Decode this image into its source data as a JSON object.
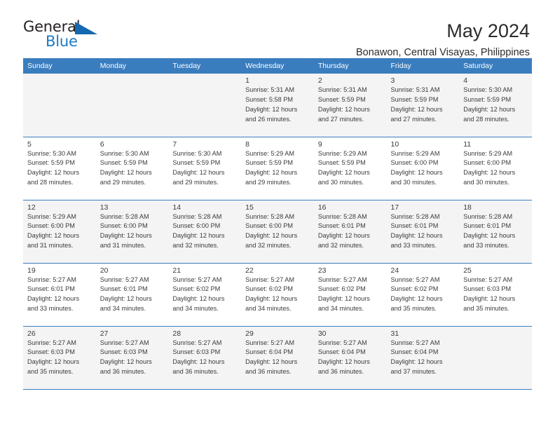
{
  "brand": {
    "name_top": "General",
    "name_bottom": "Blue",
    "triangle_color": "#1569b0",
    "blue_color": "#1a7bc4"
  },
  "header": {
    "title": "May 2024",
    "subtitle": "Bonawon, Central Visayas, Philippines"
  },
  "theme": {
    "accent": "#3a7dbf",
    "alt_row_bg": "#f4f4f4",
    "text": "#3b3b3b"
  },
  "weekday_headers": [
    "Sunday",
    "Monday",
    "Tuesday",
    "Wednesday",
    "Thursday",
    "Friday",
    "Saturday"
  ],
  "labels": {
    "sunrise": "Sunrise:",
    "sunset": "Sunset:",
    "daylight": "Daylight:"
  },
  "weeks": [
    [
      {
        "day": "",
        "sunrise": "",
        "sunset": "",
        "daylight1": "",
        "daylight2": ""
      },
      {
        "day": "",
        "sunrise": "",
        "sunset": "",
        "daylight1": "",
        "daylight2": ""
      },
      {
        "day": "",
        "sunrise": "",
        "sunset": "",
        "daylight1": "",
        "daylight2": ""
      },
      {
        "day": "1",
        "sunrise": "Sunrise: 5:31 AM",
        "sunset": "Sunset: 5:58 PM",
        "daylight1": "Daylight: 12 hours",
        "daylight2": "and 26 minutes."
      },
      {
        "day": "2",
        "sunrise": "Sunrise: 5:31 AM",
        "sunset": "Sunset: 5:59 PM",
        "daylight1": "Daylight: 12 hours",
        "daylight2": "and 27 minutes."
      },
      {
        "day": "3",
        "sunrise": "Sunrise: 5:31 AM",
        "sunset": "Sunset: 5:59 PM",
        "daylight1": "Daylight: 12 hours",
        "daylight2": "and 27 minutes."
      },
      {
        "day": "4",
        "sunrise": "Sunrise: 5:30 AM",
        "sunset": "Sunset: 5:59 PM",
        "daylight1": "Daylight: 12 hours",
        "daylight2": "and 28 minutes."
      }
    ],
    [
      {
        "day": "5",
        "sunrise": "Sunrise: 5:30 AM",
        "sunset": "Sunset: 5:59 PM",
        "daylight1": "Daylight: 12 hours",
        "daylight2": "and 28 minutes."
      },
      {
        "day": "6",
        "sunrise": "Sunrise: 5:30 AM",
        "sunset": "Sunset: 5:59 PM",
        "daylight1": "Daylight: 12 hours",
        "daylight2": "and 29 minutes."
      },
      {
        "day": "7",
        "sunrise": "Sunrise: 5:30 AM",
        "sunset": "Sunset: 5:59 PM",
        "daylight1": "Daylight: 12 hours",
        "daylight2": "and 29 minutes."
      },
      {
        "day": "8",
        "sunrise": "Sunrise: 5:29 AM",
        "sunset": "Sunset: 5:59 PM",
        "daylight1": "Daylight: 12 hours",
        "daylight2": "and 29 minutes."
      },
      {
        "day": "9",
        "sunrise": "Sunrise: 5:29 AM",
        "sunset": "Sunset: 5:59 PM",
        "daylight1": "Daylight: 12 hours",
        "daylight2": "and 30 minutes."
      },
      {
        "day": "10",
        "sunrise": "Sunrise: 5:29 AM",
        "sunset": "Sunset: 6:00 PM",
        "daylight1": "Daylight: 12 hours",
        "daylight2": "and 30 minutes."
      },
      {
        "day": "11",
        "sunrise": "Sunrise: 5:29 AM",
        "sunset": "Sunset: 6:00 PM",
        "daylight1": "Daylight: 12 hours",
        "daylight2": "and 30 minutes."
      }
    ],
    [
      {
        "day": "12",
        "sunrise": "Sunrise: 5:29 AM",
        "sunset": "Sunset: 6:00 PM",
        "daylight1": "Daylight: 12 hours",
        "daylight2": "and 31 minutes."
      },
      {
        "day": "13",
        "sunrise": "Sunrise: 5:28 AM",
        "sunset": "Sunset: 6:00 PM",
        "daylight1": "Daylight: 12 hours",
        "daylight2": "and 31 minutes."
      },
      {
        "day": "14",
        "sunrise": "Sunrise: 5:28 AM",
        "sunset": "Sunset: 6:00 PM",
        "daylight1": "Daylight: 12 hours",
        "daylight2": "and 32 minutes."
      },
      {
        "day": "15",
        "sunrise": "Sunrise: 5:28 AM",
        "sunset": "Sunset: 6:00 PM",
        "daylight1": "Daylight: 12 hours",
        "daylight2": "and 32 minutes."
      },
      {
        "day": "16",
        "sunrise": "Sunrise: 5:28 AM",
        "sunset": "Sunset: 6:01 PM",
        "daylight1": "Daylight: 12 hours",
        "daylight2": "and 32 minutes."
      },
      {
        "day": "17",
        "sunrise": "Sunrise: 5:28 AM",
        "sunset": "Sunset: 6:01 PM",
        "daylight1": "Daylight: 12 hours",
        "daylight2": "and 33 minutes."
      },
      {
        "day": "18",
        "sunrise": "Sunrise: 5:28 AM",
        "sunset": "Sunset: 6:01 PM",
        "daylight1": "Daylight: 12 hours",
        "daylight2": "and 33 minutes."
      }
    ],
    [
      {
        "day": "19",
        "sunrise": "Sunrise: 5:27 AM",
        "sunset": "Sunset: 6:01 PM",
        "daylight1": "Daylight: 12 hours",
        "daylight2": "and 33 minutes."
      },
      {
        "day": "20",
        "sunrise": "Sunrise: 5:27 AM",
        "sunset": "Sunset: 6:01 PM",
        "daylight1": "Daylight: 12 hours",
        "daylight2": "and 34 minutes."
      },
      {
        "day": "21",
        "sunrise": "Sunrise: 5:27 AM",
        "sunset": "Sunset: 6:02 PM",
        "daylight1": "Daylight: 12 hours",
        "daylight2": "and 34 minutes."
      },
      {
        "day": "22",
        "sunrise": "Sunrise: 5:27 AM",
        "sunset": "Sunset: 6:02 PM",
        "daylight1": "Daylight: 12 hours",
        "daylight2": "and 34 minutes."
      },
      {
        "day": "23",
        "sunrise": "Sunrise: 5:27 AM",
        "sunset": "Sunset: 6:02 PM",
        "daylight1": "Daylight: 12 hours",
        "daylight2": "and 34 minutes."
      },
      {
        "day": "24",
        "sunrise": "Sunrise: 5:27 AM",
        "sunset": "Sunset: 6:02 PM",
        "daylight1": "Daylight: 12 hours",
        "daylight2": "and 35 minutes."
      },
      {
        "day": "25",
        "sunrise": "Sunrise: 5:27 AM",
        "sunset": "Sunset: 6:03 PM",
        "daylight1": "Daylight: 12 hours",
        "daylight2": "and 35 minutes."
      }
    ],
    [
      {
        "day": "26",
        "sunrise": "Sunrise: 5:27 AM",
        "sunset": "Sunset: 6:03 PM",
        "daylight1": "Daylight: 12 hours",
        "daylight2": "and 35 minutes."
      },
      {
        "day": "27",
        "sunrise": "Sunrise: 5:27 AM",
        "sunset": "Sunset: 6:03 PM",
        "daylight1": "Daylight: 12 hours",
        "daylight2": "and 36 minutes."
      },
      {
        "day": "28",
        "sunrise": "Sunrise: 5:27 AM",
        "sunset": "Sunset: 6:03 PM",
        "daylight1": "Daylight: 12 hours",
        "daylight2": "and 36 minutes."
      },
      {
        "day": "29",
        "sunrise": "Sunrise: 5:27 AM",
        "sunset": "Sunset: 6:04 PM",
        "daylight1": "Daylight: 12 hours",
        "daylight2": "and 36 minutes."
      },
      {
        "day": "30",
        "sunrise": "Sunrise: 5:27 AM",
        "sunset": "Sunset: 6:04 PM",
        "daylight1": "Daylight: 12 hours",
        "daylight2": "and 36 minutes."
      },
      {
        "day": "31",
        "sunrise": "Sunrise: 5:27 AM",
        "sunset": "Sunset: 6:04 PM",
        "daylight1": "Daylight: 12 hours",
        "daylight2": "and 37 minutes."
      },
      {
        "day": "",
        "sunrise": "",
        "sunset": "",
        "daylight1": "",
        "daylight2": ""
      }
    ]
  ]
}
